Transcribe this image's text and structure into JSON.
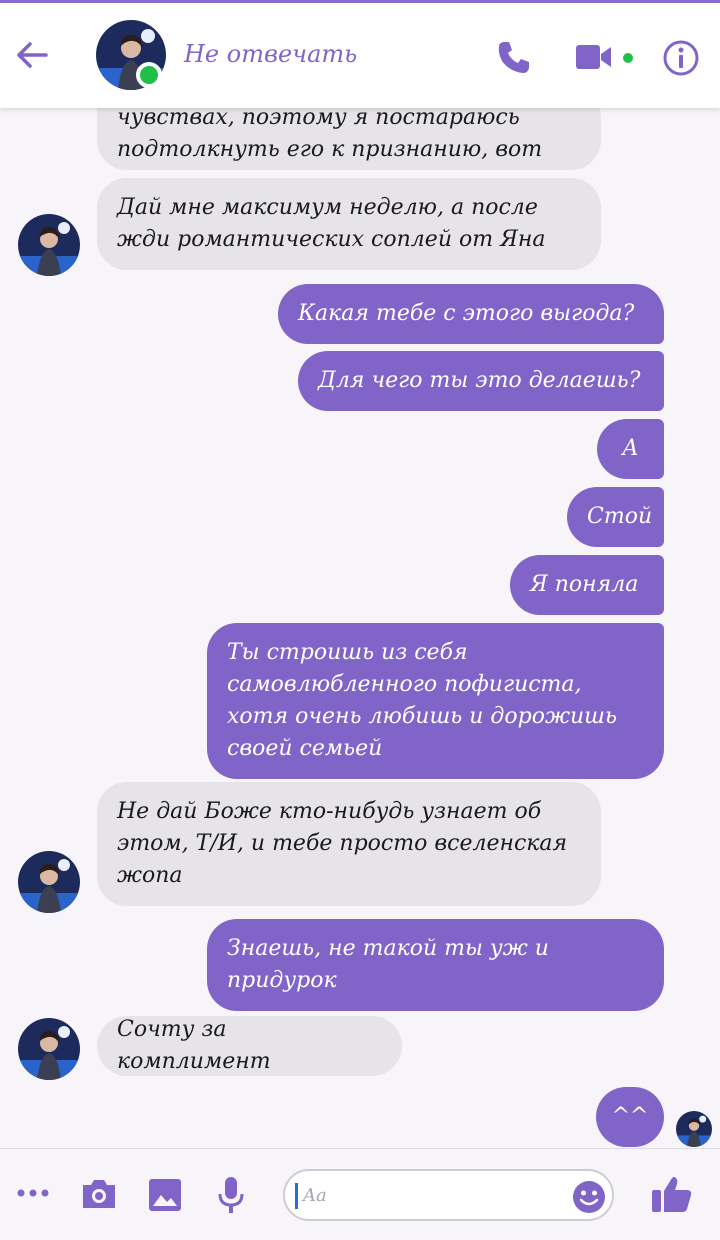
{
  "colors": {
    "accent": "#8064c8",
    "incoming_bubble": "#e6e4e9",
    "online": "#1fbf4a"
  },
  "header": {
    "contact_name": "Не отвечать",
    "icons": [
      "back-arrow-icon",
      "phone-icon",
      "video-icon",
      "info-icon"
    ]
  },
  "messages": [
    {
      "from": "contact",
      "text": "чувствах, поэтому я постараюсь\nподтолкнуть его к признанию, вот"
    },
    {
      "from": "contact",
      "text": "Дай мне максимум неделю, а после\nжди романтических соплей от Яна"
    },
    {
      "from": "me",
      "text": "Какая тебе с этого выгода?"
    },
    {
      "from": "me",
      "text": "Для чего ты это делаешь?"
    },
    {
      "from": "me",
      "text": "А"
    },
    {
      "from": "me",
      "text": "Стой"
    },
    {
      "from": "me",
      "text": "Я поняла"
    },
    {
      "from": "me",
      "text": "Ты строишь из себя\nсамовлюбленного пофигиста,\nхотя очень любишь и дорожишь\nсвоей семьей"
    },
    {
      "from": "contact",
      "text": "Не дай Боже кто-нибудь узнает об\nэтом, Т/И, и тебе просто вселенская\nжопа"
    },
    {
      "from": "me",
      "text": "Знаешь, не такой ты уж и\nпридурок"
    },
    {
      "from": "contact",
      "text": "Сочту за комплимент"
    },
    {
      "from": "me",
      "text": "^^"
    }
  ],
  "composer": {
    "placeholder": "Aa",
    "icons": [
      "more-icon",
      "camera-icon",
      "image-icon",
      "microphone-icon",
      "emoji-icon",
      "like-icon"
    ]
  }
}
